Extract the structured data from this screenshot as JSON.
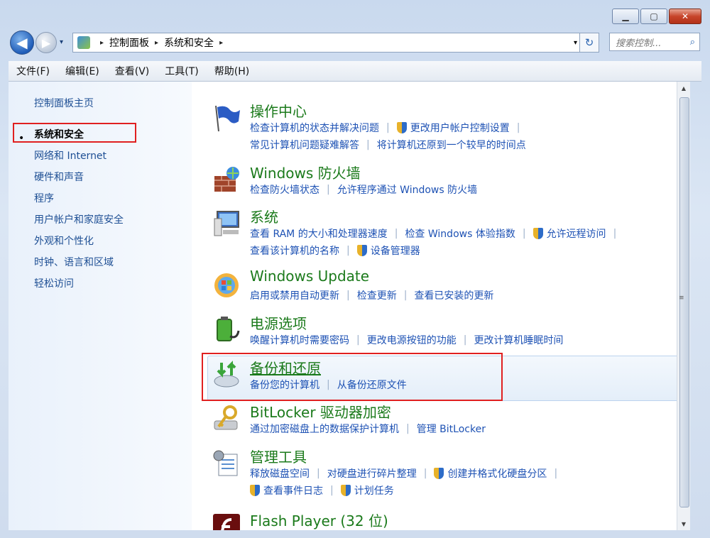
{
  "window": {
    "minimize": "▁",
    "maximize": "▢",
    "close": "✕"
  },
  "nav": {
    "back": "◀",
    "forward": "▶",
    "history_dropdown": "▾",
    "refresh": "↻"
  },
  "breadcrumb": [
    "控制面板",
    "系统和安全"
  ],
  "address": {
    "separator": "▸",
    "dropdown": "▾"
  },
  "search": {
    "placeholder": "搜索控制...",
    "icon": "⌕"
  },
  "menu": [
    "文件(F)",
    "编辑(E)",
    "查看(V)",
    "工具(T)",
    "帮助(H)"
  ],
  "sidebar": {
    "home": "控制面板主页",
    "bullet": "•",
    "items": [
      "系统和安全",
      "网络和 Internet",
      "硬件和声音",
      "程序",
      "用户帐户和家庭安全",
      "外观和个性化",
      "时钟、语言和区域",
      "轻松访问"
    ]
  },
  "categories": [
    {
      "title": "操作中心",
      "rows": [
        [
          "检查计算机的状态并解决问题",
          "更改用户帐户控制设置"
        ],
        [
          "常见计算机问题疑难解答",
          "将计算机还原到一个较早的时间点"
        ]
      ]
    },
    {
      "title": "Windows 防火墙",
      "rows": [
        [
          "检查防火墙状态",
          "允许程序通过 Windows 防火墙"
        ]
      ]
    },
    {
      "title": "系统",
      "rows": [
        [
          "查看 RAM 的大小和处理器速度",
          "检查 Windows 体验指数",
          "允许远程访问"
        ],
        [
          "查看该计算机的名称",
          "设备管理器"
        ]
      ]
    },
    {
      "title": "Windows Update",
      "rows": [
        [
          "启用或禁用自动更新",
          "检查更新",
          "查看已安装的更新"
        ]
      ]
    },
    {
      "title": "电源选项",
      "rows": [
        [
          "唤醒计算机时需要密码",
          "更改电源按钮的功能",
          "更改计算机睡眠时间"
        ]
      ]
    },
    {
      "title": "备份和还原",
      "rows": [
        [
          "备份您的计算机",
          "从备份还原文件"
        ]
      ]
    },
    {
      "title": "BitLocker 驱动器加密",
      "rows": [
        [
          "通过加密磁盘上的数据保护计算机",
          "管理 BitLocker"
        ]
      ]
    },
    {
      "title": "管理工具",
      "rows": [
        [
          "释放磁盘空间",
          "对硬盘进行碎片整理",
          "创建并格式化硬盘分区"
        ],
        [
          "查看事件日志",
          "计划任务"
        ]
      ]
    },
    {
      "title": "Flash Player (32 位)",
      "rows": []
    }
  ],
  "scrollbar": {
    "up": "▲",
    "down": "▼",
    "grip": "≡"
  },
  "colors": {
    "title_green": "#1b7a1b",
    "link_blue": "#1e52b4",
    "highlight_red": "#e02020"
  }
}
